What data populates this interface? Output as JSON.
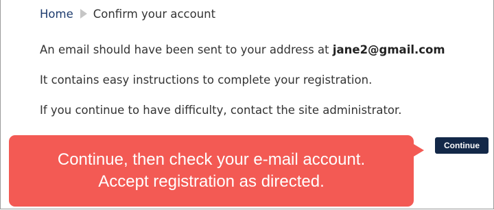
{
  "breadcrumb": {
    "home": "Home",
    "current": "Confirm your account"
  },
  "message": {
    "line1_prefix": "An email should have been sent to your address at",
    "email": "jane2@gmail.com",
    "line2": "It contains easy instructions to complete your registration.",
    "line3": "If you continue to have difficulty, contact the site administrator."
  },
  "callout": {
    "line1": "Continue, then check your e-mail account.",
    "line2": "Accept registration as directed."
  },
  "actions": {
    "continue_label": "Continue"
  },
  "colors": {
    "link": "#1d3b6e",
    "callout_bg": "#f35a54",
    "button_bg": "#132848"
  }
}
